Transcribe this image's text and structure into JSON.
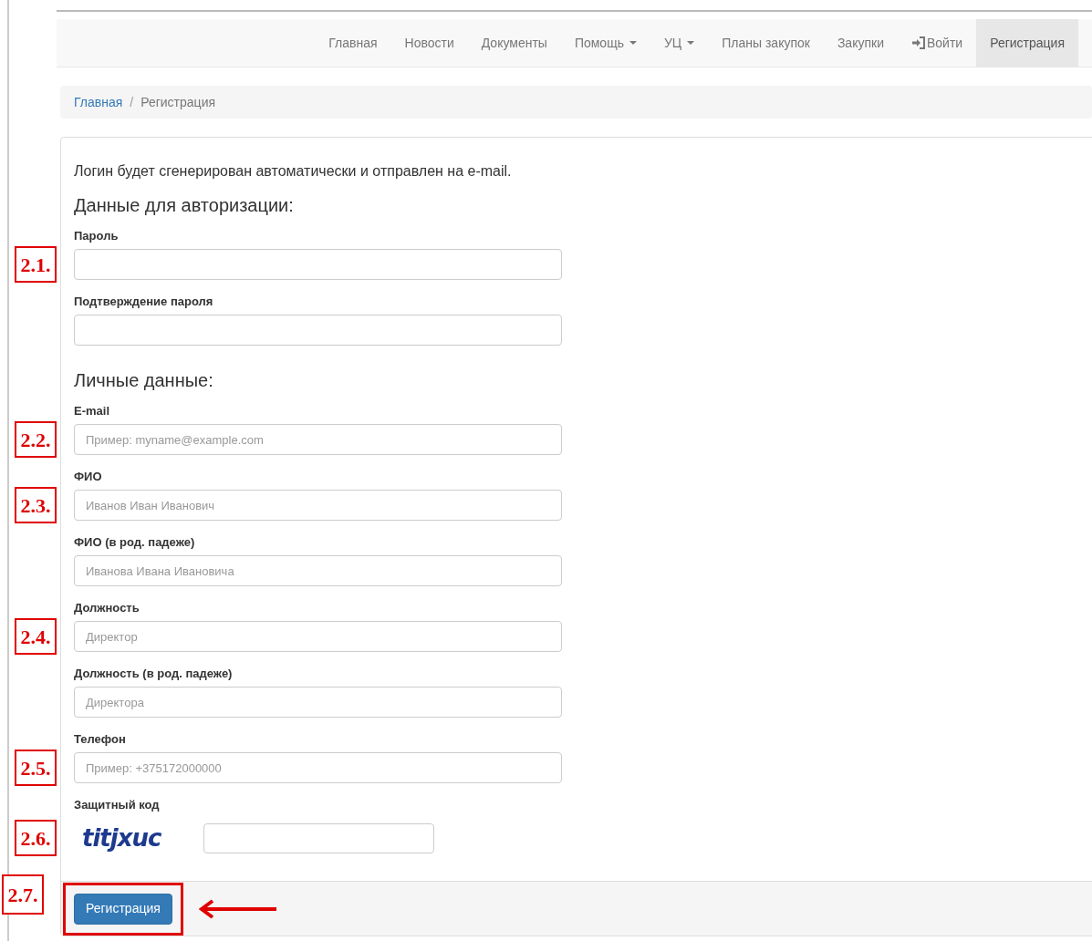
{
  "navbar": {
    "items": [
      {
        "label": "Главная",
        "selected": false,
        "kind": "plain"
      },
      {
        "label": "Новости",
        "selected": false,
        "kind": "plain"
      },
      {
        "label": "Документы",
        "selected": false,
        "kind": "plain"
      },
      {
        "label": "Помощь",
        "selected": false,
        "kind": "dropdown"
      },
      {
        "label": "УЦ",
        "selected": false,
        "kind": "dropdown"
      },
      {
        "label": "Планы закупок",
        "selected": false,
        "kind": "plain"
      },
      {
        "label": "Закупки",
        "selected": false,
        "kind": "plain"
      },
      {
        "label": "Войти",
        "selected": false,
        "kind": "login"
      },
      {
        "label": "Регистрация",
        "selected": true,
        "kind": "plain"
      }
    ]
  },
  "breadcrumb": {
    "separator": "/",
    "items": [
      {
        "label": "Главная",
        "kind": "link"
      },
      {
        "label": "Регистрация",
        "kind": "current"
      }
    ]
  },
  "form": {
    "intro": "Логин будет сгенерирован автоматически и отправлен на e-mail.",
    "sections": [
      {
        "heading": "Данные для авторизации:",
        "fields": [
          {
            "kind": "text",
            "label": "Пароль",
            "annotation": "2.1."
          },
          {
            "kind": "text",
            "label": "Подтверждение пароля"
          }
        ]
      },
      {
        "heading": "Личные данные:",
        "fields": [
          {
            "kind": "text",
            "label": "E-mail",
            "placeholder": "Пример: myname@example.com",
            "annotation": "2.2."
          },
          {
            "kind": "text",
            "label": "ФИО",
            "placeholder": "Иванов Иван Иванович",
            "annotation": "2.3."
          },
          {
            "kind": "text",
            "label": "ФИО (в род. падеже)",
            "placeholder": "Иванова Ивана Ивановича"
          },
          {
            "kind": "text",
            "label": "Должность",
            "placeholder": "Директор",
            "annotation": "2.4."
          },
          {
            "kind": "text",
            "label": "Должность (в род. падеже)",
            "placeholder": "Директора"
          },
          {
            "kind": "text",
            "label": "Телефон",
            "placeholder": "Пример: +375172000000",
            "annotation": "2.5."
          },
          {
            "kind": "captcha",
            "label": "Защитный код",
            "captcha_text": "titjxuc",
            "annotation": "2.6."
          }
        ]
      }
    ],
    "submit": {
      "label": "Регистрация",
      "annotation": "2.7.",
      "highlighted": true
    }
  }
}
